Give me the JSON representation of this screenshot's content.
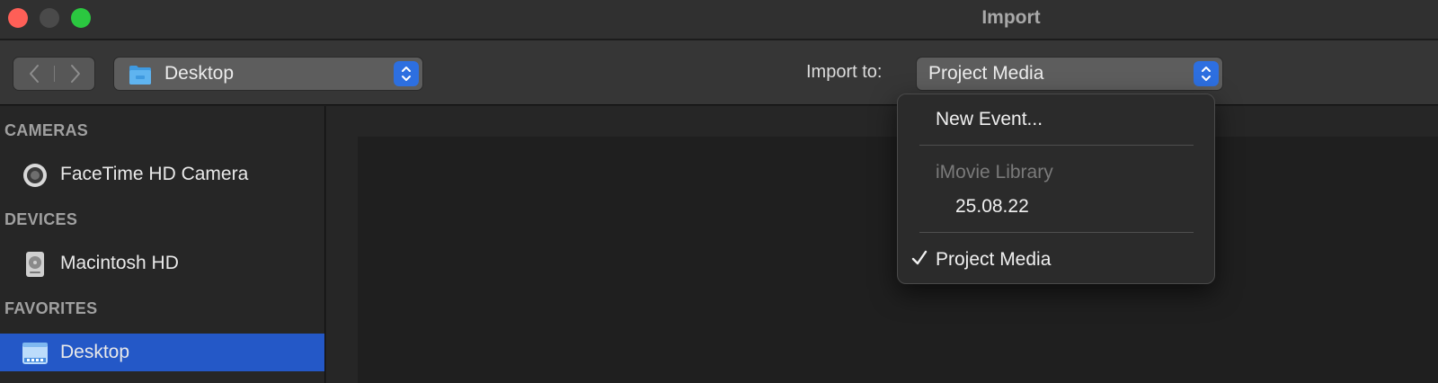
{
  "window": {
    "title": "Import"
  },
  "toolbar": {
    "location_label": "Desktop",
    "import_to_label": "Import to:",
    "import_to_value": "Project Media"
  },
  "sidebar": {
    "sections": [
      {
        "title": "CAMERAS",
        "items": [
          {
            "label": "FaceTime HD Camera",
            "icon": "camera-icon"
          }
        ]
      },
      {
        "title": "DEVICES",
        "items": [
          {
            "label": "Macintosh HD",
            "icon": "hard-drive-icon"
          }
        ]
      },
      {
        "title": "FAVORITES",
        "items": [
          {
            "label": "Desktop",
            "icon": "desktop-icon",
            "selected": true
          }
        ]
      }
    ]
  },
  "menu": {
    "items": [
      {
        "label": "New Event..."
      },
      {
        "label": "iMovie Library",
        "disabled": true
      },
      {
        "label": "25.08.22"
      },
      {
        "label": "Project Media",
        "checked": true
      }
    ]
  },
  "colors": {
    "accent": "#2d6fe0",
    "selection": "#2458c7",
    "close": "#fe5f57",
    "zoom": "#2bc840"
  }
}
